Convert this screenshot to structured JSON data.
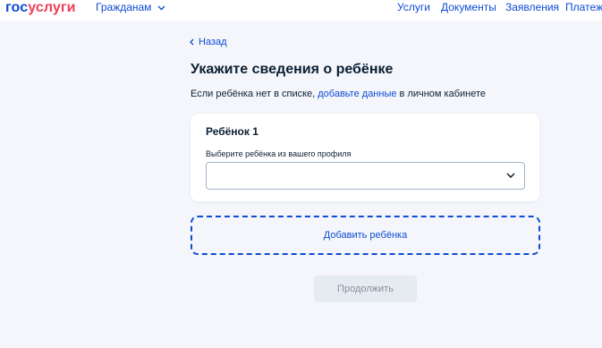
{
  "header": {
    "logo_part1": "гос",
    "logo_part2": "услуги",
    "audience_label": "Гражданам",
    "nav": [
      "Услуги",
      "Документы",
      "Заявления",
      "Платежи"
    ]
  },
  "back_label": "Назад",
  "page_title": "Укажите сведения о ребёнке",
  "info": {
    "prefix": "Если ребёнка нет в списке, ",
    "link": "добавьте данные",
    "suffix": " в личном кабинете"
  },
  "child_card": {
    "title": "Ребёнок 1",
    "select_label": "Выберите ребёнка из вашего профиля",
    "select_value": ""
  },
  "add_child_label": "Добавить ребёнка",
  "continue_label": "Продолжить",
  "colors": {
    "brand_blue": "#0d4cd3",
    "brand_red": "#ee3f58",
    "background": "#f4f6fb",
    "disabled_button": "#e6ebf1"
  }
}
